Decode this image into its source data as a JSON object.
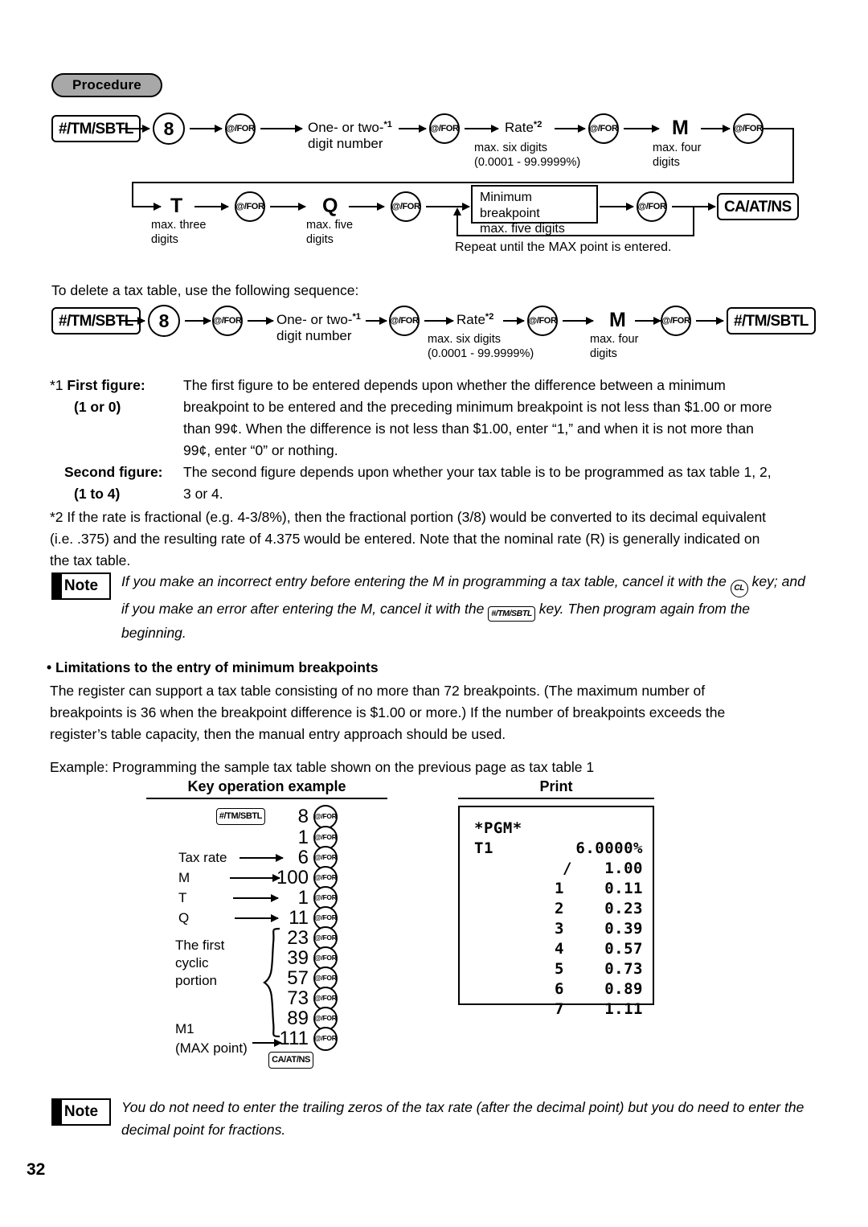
{
  "page": {
    "number": "32",
    "section_badge": "Procedure"
  },
  "flow1": {
    "row1": [
      {
        "type": "key-rect",
        "label": "#/TM/SBTL"
      },
      {
        "type": "circle-num",
        "label": "8"
      },
      {
        "type": "circle-for",
        "label": "@/FOR"
      },
      {
        "type": "text",
        "label": "One- or two-",
        "sup": "*1",
        "label2": "digit number"
      },
      {
        "type": "circle-for",
        "label": "@/FOR"
      },
      {
        "type": "text",
        "label": "Rate",
        "sup": "*2",
        "note1": "max. six digits",
        "note2": "(0.0001 - 99.9999%)"
      },
      {
        "type": "circle-for",
        "label": "@/FOR"
      },
      {
        "type": "letter",
        "label": "M",
        "note1": "max. four",
        "note2": "digits"
      },
      {
        "type": "circle-for",
        "label": "@/FOR"
      }
    ],
    "row2": [
      {
        "type": "letter",
        "label": "T",
        "note1": "max. three",
        "note2": "digits"
      },
      {
        "type": "circle-for",
        "label": "@/FOR"
      },
      {
        "type": "letter",
        "label": "Q",
        "note1": "max. five",
        "note2": "digits"
      },
      {
        "type": "circle-for",
        "label": "@/FOR"
      },
      {
        "type": "box",
        "label": "Minimum breakpoint",
        "label2": "max. five digits"
      },
      {
        "type": "circle-for",
        "label": "@/FOR"
      },
      {
        "type": "key-rect",
        "label": "CA/AT/NS"
      }
    ],
    "repeat_caption": "Repeat until the MAX point is entered."
  },
  "delete_intro": "To delete a tax table, use the following sequence:",
  "flow2": [
    {
      "type": "key-rect",
      "label": "#/TM/SBTL"
    },
    {
      "type": "circle-num",
      "label": "8"
    },
    {
      "type": "circle-for",
      "label": "@/FOR"
    },
    {
      "type": "text",
      "label": "One- or two-",
      "sup": "*1",
      "label2": "digit number"
    },
    {
      "type": "circle-for",
      "label": "@/FOR"
    },
    {
      "type": "text",
      "label": "Rate",
      "sup": "*2",
      "note1": "max. six digits",
      "note2": "(0.0001 - 99.9999%)"
    },
    {
      "type": "circle-for",
      "label": "@/FOR"
    },
    {
      "type": "letter",
      "label": "M",
      "note1": "max. four",
      "note2": "digits"
    },
    {
      "type": "circle-for",
      "label": "@/FOR"
    },
    {
      "type": "key-rect",
      "label": "#/TM/SBTL"
    }
  ],
  "footnotes": {
    "star1_marker": "*1",
    "first_figure_label": "First figure:",
    "first_figure_range": "(1 or 0)",
    "first_figure_text": "The first figure to be entered depends upon whether the difference between a minimum breakpoint to be entered and the preceding minimum breakpoint is not less than $1.00 or more than 99¢. When the difference is not less than $1.00, enter “1,” and when it is not more than 99¢, enter “0” or nothing.",
    "second_figure_label": "Second figure:",
    "second_figure_range": "(1 to 4)",
    "second_figure_text": "The second figure depends upon whether your tax table is to be programmed as tax table 1, 2, 3 or 4.",
    "star2_text": "*2 If the rate is fractional (e.g. 4-3/8%), then the fractional portion (3/8) would be converted to its decimal equivalent (i.e. .375) and the resulting rate of 4.375 would be entered. Note that the nominal rate (R) is generally indicated on the tax table."
  },
  "note1": {
    "tag": "Note",
    "part1": "If you make an incorrect entry before entering the M in programming a tax table, cancel it with the",
    "key_cl": "CL",
    "part2": "key; and if you make an error after entering the M, cancel it with the",
    "key_sbtl": "#/TM/SBTL",
    "part3": "key.  Then program again from the beginning."
  },
  "limitations": {
    "heading": "• Limitations to the entry of minimum breakpoints",
    "text": "The register can support a tax table consisting of no more than 72 breakpoints. (The maximum number of breakpoints is 36 when the breakpoint difference is $1.00 or more.) If the number of breakpoints exceeds the register’s table capacity, then the manual entry approach should be used."
  },
  "example": {
    "intro": "Example: Programming the sample tax table shown on the previous page as tax table 1",
    "col1_header": "Key operation example",
    "col2_header": "Print",
    "key_rows": [
      {
        "lead": "",
        "prefix_key": "#/TM/SBTL",
        "value": "8",
        "suffix": "@/FOR"
      },
      {
        "lead": "",
        "prefix_key": "",
        "value": "1",
        "suffix": "@/FOR"
      },
      {
        "lead": "Tax rate",
        "prefix_key": "",
        "value": "6",
        "suffix": "@/FOR"
      },
      {
        "lead": "M",
        "prefix_key": "",
        "value": "100",
        "suffix": "@/FOR"
      },
      {
        "lead": "T",
        "prefix_key": "",
        "value": "1",
        "suffix": "@/FOR"
      },
      {
        "lead": "Q",
        "prefix_key": "",
        "value": "11",
        "suffix": "@/FOR"
      },
      {
        "lead": "",
        "prefix_key": "",
        "value": "23",
        "suffix": "@/FOR"
      },
      {
        "lead": "",
        "prefix_key": "",
        "value": "39",
        "suffix": "@/FOR"
      },
      {
        "lead": "",
        "prefix_key": "",
        "value": "57",
        "suffix": "@/FOR"
      },
      {
        "lead": "",
        "prefix_key": "",
        "value": "73",
        "suffix": "@/FOR"
      },
      {
        "lead": "",
        "prefix_key": "",
        "value": "89",
        "suffix": "@/FOR"
      },
      {
        "lead": "",
        "prefix_key": "",
        "value": "111",
        "suffix": "@/FOR"
      }
    ],
    "final_key": "CA/AT/NS",
    "brace_label_line1": "The first",
    "brace_label_line2": "cyclic",
    "brace_label_line3": "portion",
    "max_label_line1": "M1",
    "max_label_line2": "(MAX point)",
    "receipt": {
      "title": "*PGM*",
      "table_id": "T1",
      "rate": "6.0000%",
      "divider_symbol": "/",
      "divider_value": "1.00",
      "rows": [
        {
          "index": "1",
          "value": "0.11"
        },
        {
          "index": "2",
          "value": "0.23"
        },
        {
          "index": "3",
          "value": "0.39"
        },
        {
          "index": "4",
          "value": "0.57"
        },
        {
          "index": "5",
          "value": "0.73"
        },
        {
          "index": "6",
          "value": "0.89"
        },
        {
          "index": "7",
          "value": "1.11"
        }
      ]
    }
  },
  "note2": {
    "tag": "Note",
    "text": "You do not need to enter the trailing zeros of the tax rate (after the decimal point) but you do need to enter the decimal point for fractions."
  }
}
